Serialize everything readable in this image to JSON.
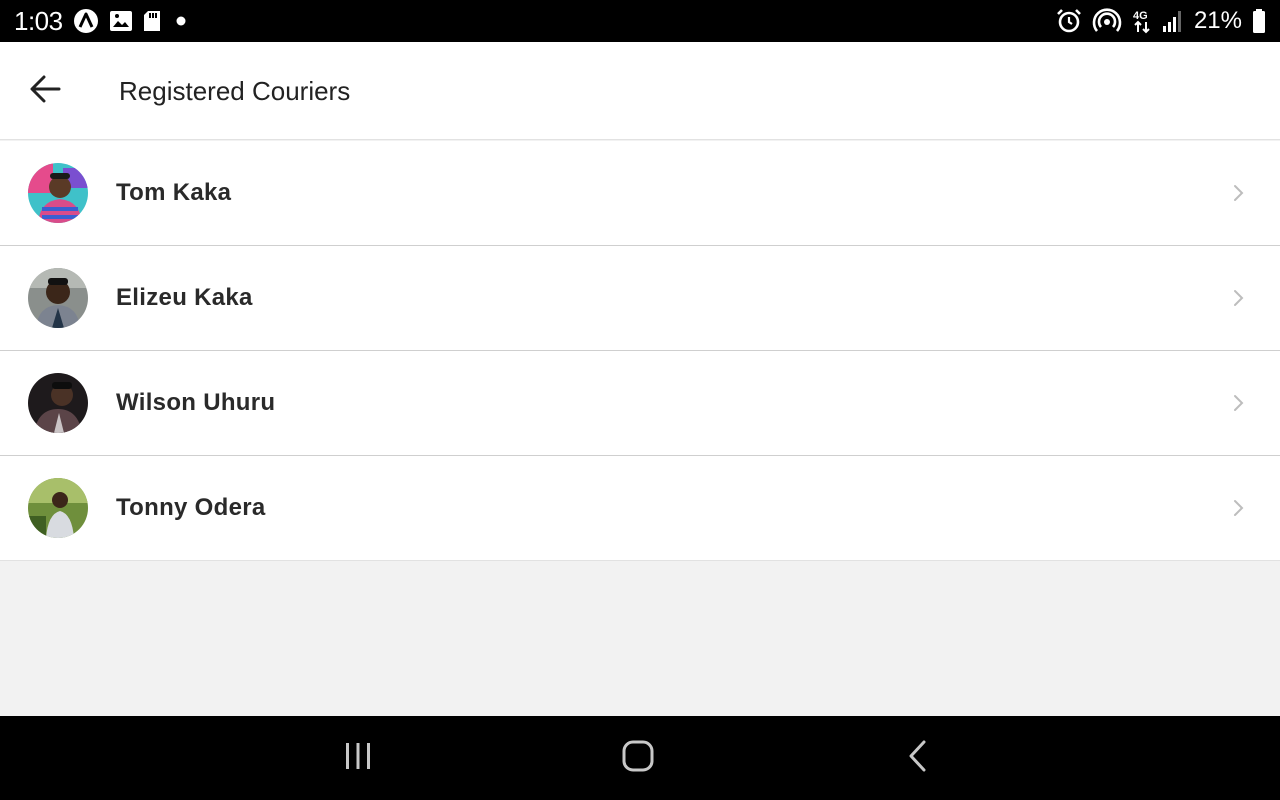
{
  "status_bar": {
    "time": "1:03",
    "battery_percent": "21%",
    "network": "4G",
    "icons_left": [
      "a-logo-icon",
      "image-icon",
      "sd-card-icon",
      "dot-icon"
    ],
    "icons_right": [
      "alarm-icon",
      "hotspot-icon",
      "network-4g-icon",
      "signal-icon",
      "battery-icon"
    ]
  },
  "app_bar": {
    "title": "Registered Couriers",
    "back_icon": "arrow-left-icon"
  },
  "couriers": [
    {
      "name": "Tom Kaka"
    },
    {
      "name": "Elizeu Kaka"
    },
    {
      "name": "Wilson Uhuru"
    },
    {
      "name": "Tonny Odera"
    }
  ],
  "nav_bar": {
    "buttons": [
      "recents-icon",
      "home-icon",
      "back-icon"
    ]
  },
  "colors": {
    "background": "#f2f2f2",
    "list_background": "#ffffff",
    "divider": "#cfcfcf",
    "text": "#222222",
    "chevron": "#bdbdbd"
  }
}
